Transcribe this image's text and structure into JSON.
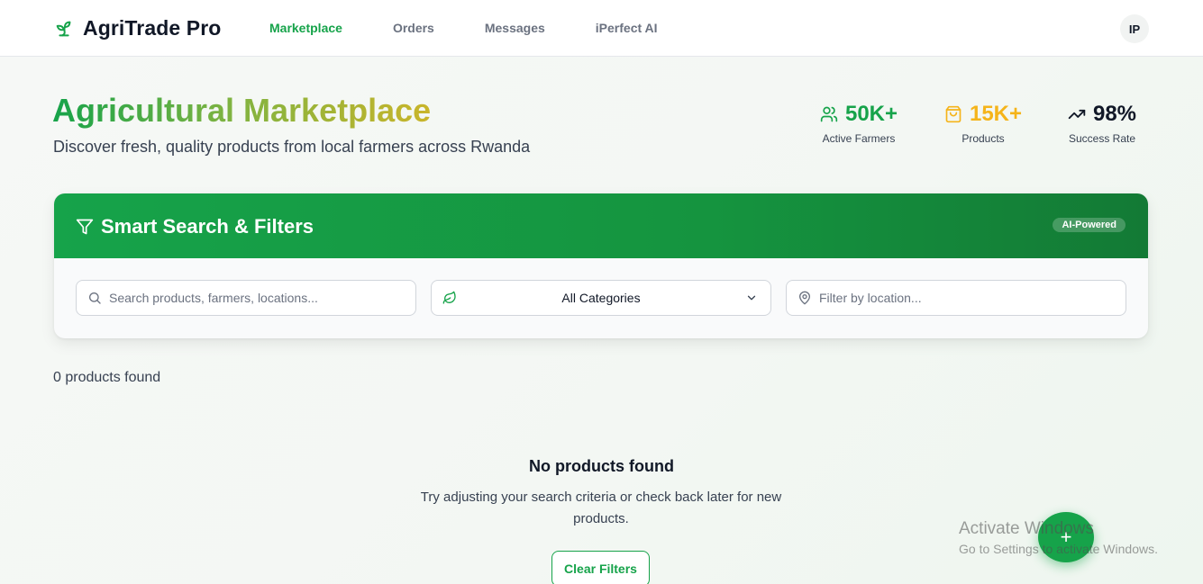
{
  "header": {
    "brand": "AgriTrade Pro",
    "nav": [
      {
        "label": "Marketplace",
        "active": true
      },
      {
        "label": "Orders",
        "active": false
      },
      {
        "label": "Messages",
        "active": false
      },
      {
        "label": "iPerfect AI",
        "active": false
      }
    ],
    "avatar_initials": "IP"
  },
  "hero": {
    "title": "Agricultural Marketplace",
    "subtitle": "Discover fresh, quality products from local farmers across Rwanda"
  },
  "stats": [
    {
      "value": "50K+",
      "label": "Active Farmers",
      "color": "#16a34a",
      "icon": "users-icon"
    },
    {
      "value": "15K+",
      "label": "Products",
      "color": "#f5b41a",
      "icon": "shopping-bag-icon"
    },
    {
      "value": "98%",
      "label": "Success Rate",
      "color": "#111827",
      "icon": "trending-up-icon"
    }
  ],
  "filters": {
    "title": "Smart Search & Filters",
    "badge": "AI-Powered",
    "search_placeholder": "Search products, farmers, locations...",
    "category_value": "All Categories",
    "location_placeholder": "Filter by location..."
  },
  "results": {
    "count_text": "0 products found",
    "empty_title": "No products found",
    "empty_text": "Try adjusting your search criteria or check back later for new products.",
    "clear_button": "Clear Filters"
  },
  "fab": {
    "icon": "plus-icon",
    "label": "+"
  },
  "watermark": {
    "line1": "Activate Windows",
    "line2": "Go to Settings to activate Windows."
  },
  "colors": {
    "brand_green": "#16a34a",
    "accent_gold": "#f5b41a"
  }
}
